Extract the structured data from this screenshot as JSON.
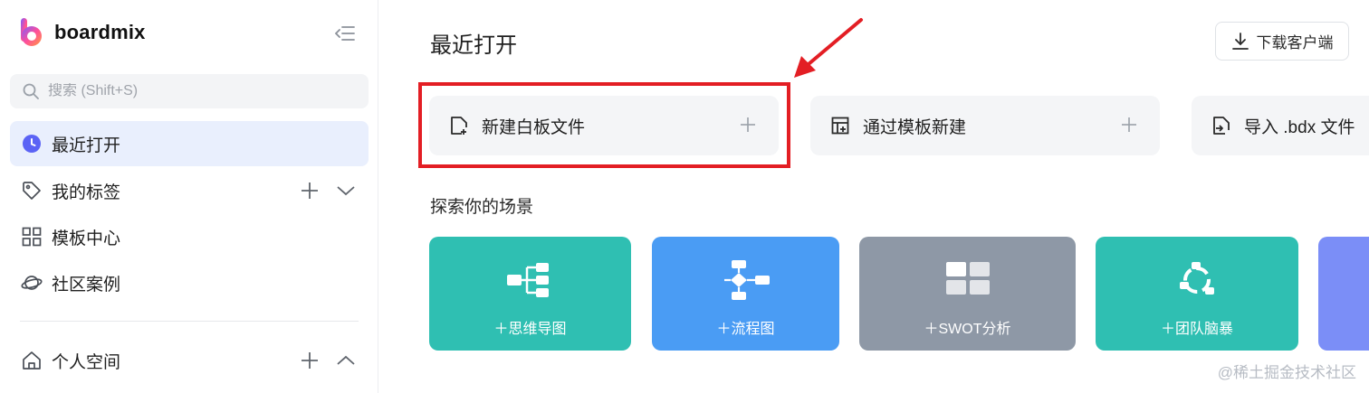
{
  "brand": {
    "name": "boardmix"
  },
  "sidebar": {
    "search_placeholder": "搜索 (Shift+S)",
    "items": [
      {
        "label": "最近打开",
        "icon": "clock-icon",
        "active": true
      },
      {
        "label": "我的标签",
        "icon": "tag-icon"
      },
      {
        "label": "模板中心",
        "icon": "grid-icon"
      },
      {
        "label": "社区案例",
        "icon": "planet-icon"
      }
    ],
    "personal_space": {
      "label": "个人空间",
      "icon": "home-icon"
    }
  },
  "main": {
    "title": "最近打开",
    "download_label": "下载客户端",
    "actions": [
      {
        "label": "新建白板文件",
        "icon": "new-file-icon"
      },
      {
        "label": "通过模板新建",
        "icon": "template-icon"
      },
      {
        "label": "导入 .bdx 文件",
        "icon": "import-icon"
      }
    ],
    "section_title": "探索你的场景",
    "scenes": [
      {
        "label": "＋思维导图",
        "color": "#2fbfb2",
        "icon": "mindmap-icon"
      },
      {
        "label": "＋流程图",
        "color": "#4a9cf4",
        "icon": "flowchart-icon"
      },
      {
        "label": "＋SWOT分析",
        "color": "#8e98a6",
        "icon": "swot-icon"
      },
      {
        "label": "＋团队脑暴",
        "color": "#2fbfb2",
        "icon": "brainstorm-icon"
      }
    ]
  },
  "watermark": "@稀土掘金技术社区",
  "colors": {
    "accent": "#5b63f5",
    "highlight": "#e31e24",
    "active_bg": "#e9effd"
  }
}
